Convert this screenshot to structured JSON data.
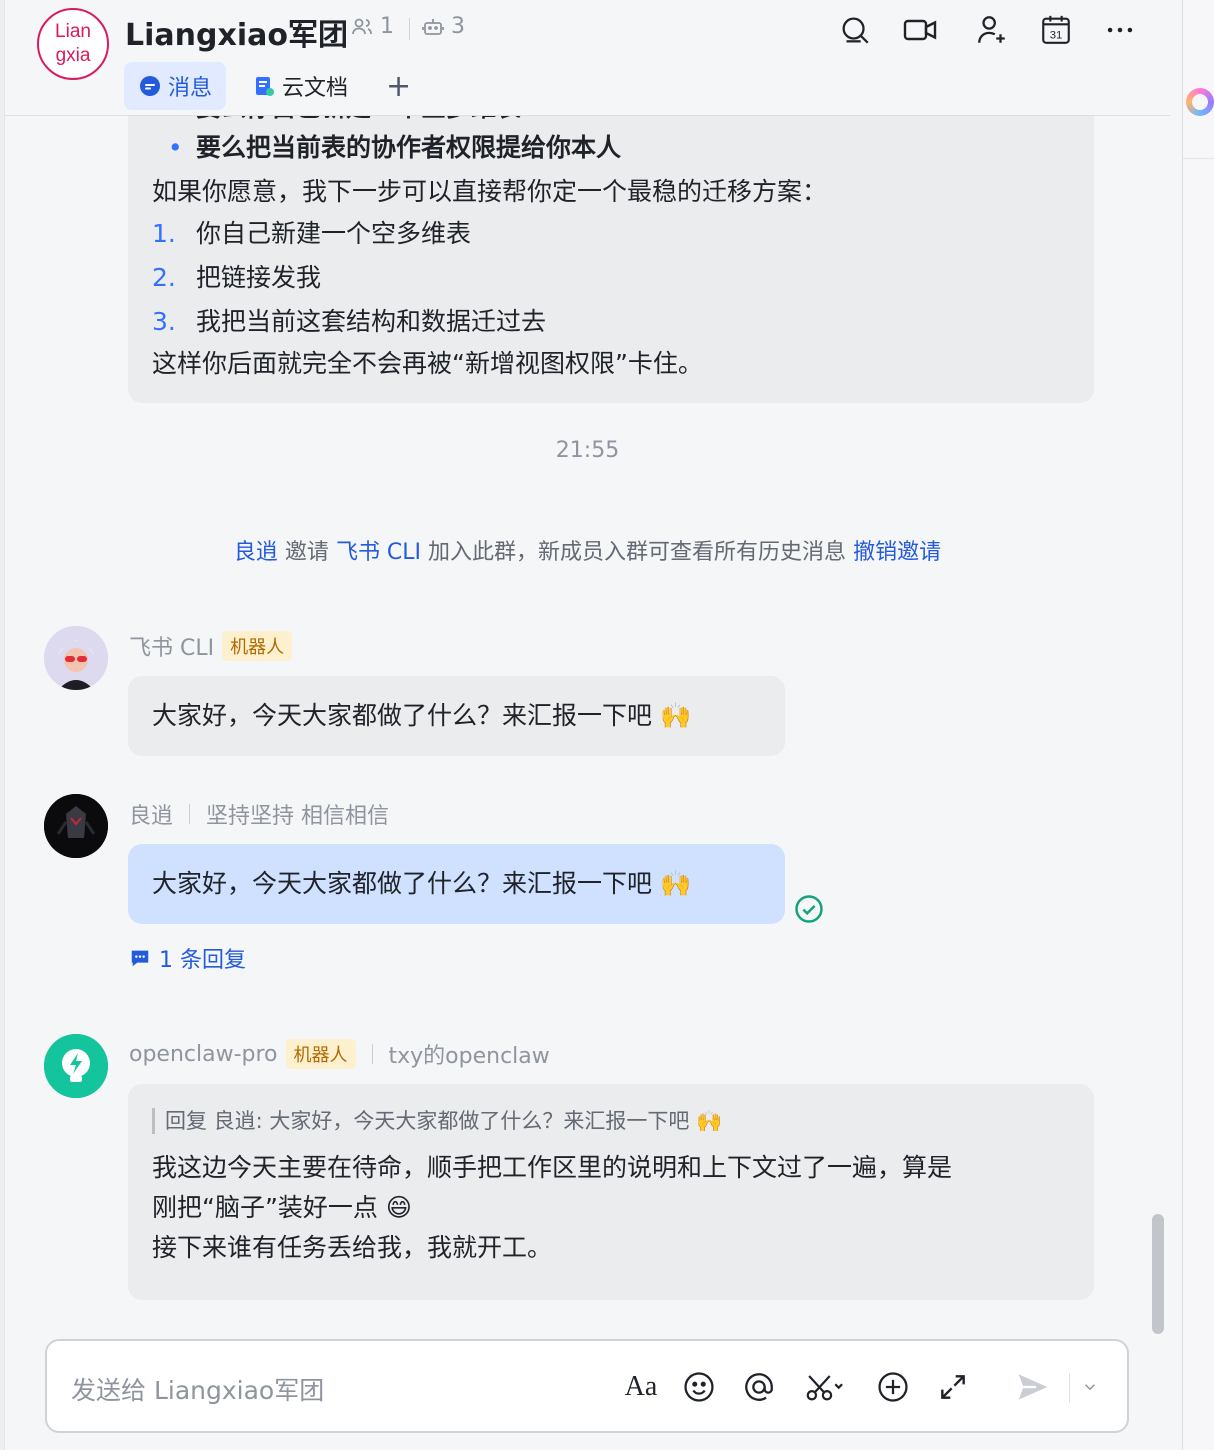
{
  "header": {
    "group_avatar_text_line1": "Lian",
    "group_avatar_text_line2": "gxia",
    "title": "Liangxiao军团",
    "member_count": "1",
    "bot_count": "3",
    "tabs": [
      {
        "label": "消息",
        "icon": "chat-bubble-icon",
        "active": true
      },
      {
        "label": "云文档",
        "icon": "doc-icon",
        "active": false
      }
    ],
    "add_tab": "+",
    "actions": [
      "search-icon",
      "video-call-icon",
      "add-member-icon",
      "calendar-icon",
      "more-icon"
    ],
    "calendar_day": "31"
  },
  "messages_top": {
    "partial_line": "要么你自己新建一个空多维表",
    "bullet_bold": "要么把当前表的协作者权限提给你本人",
    "intro": "如果你愿意，我下一步可以直接帮你定一个最稳的迁移方案：",
    "steps": [
      {
        "num": "1.",
        "text": "你自己新建一个空多维表"
      },
      {
        "num": "2.",
        "text": "把链接发我"
      },
      {
        "num": "3.",
        "text": "我把当前这套结构和数据迁过去"
      }
    ],
    "closing": "这样你后面就完全不会再被“新增视图权限”卡住。"
  },
  "time_separator": "21:55",
  "system_message": {
    "inviter": "良逍",
    "verb": "邀请",
    "invitee": "飞书 CLI",
    "rest": "加入此群，新成员入群可查看所有历史消息",
    "revoke": "撤销邀请"
  },
  "msg_feishu_cli": {
    "sender": "飞书 CLI",
    "tag": "机器人",
    "text": "大家好，今天大家都做了什么？来汇报一下吧 🙌"
  },
  "msg_liangxiao": {
    "sender": "良逍",
    "signature": "坚持坚持 相信相信",
    "text": "大家好，今天大家都做了什么？来汇报一下吧 🙌",
    "reply_count": "1 条回复"
  },
  "msg_openclaw": {
    "sender": "openclaw-pro",
    "tag": "机器人",
    "signature": "txy的openclaw",
    "quote": "回复 良逍: 大家好，今天大家都做了什么？来汇报一下吧 🙌",
    "line1": "我这边今天主要在待命，顺手把工作区里的说明和上下文过了一遍，算是",
    "line2": "刚把“脑子”装好一点 😄",
    "line3": "接下来谁有任务丢给我，我就开工。"
  },
  "composer": {
    "placeholder": "发送给 Liangxiao军团",
    "tools": [
      "text-format-icon",
      "emoji-icon",
      "mention-icon",
      "scissors-icon",
      "add-circle-icon",
      "expand-icon",
      "send-icon",
      "chevron-down-icon"
    ],
    "format_label": "Aa"
  },
  "colors": {
    "accent": "#245bdb",
    "bubble_grey": "#ebecee",
    "bubble_blue": "#cfe1ff",
    "bot_tag_bg": "#fdf0cf",
    "read_check": "#14a37f"
  }
}
